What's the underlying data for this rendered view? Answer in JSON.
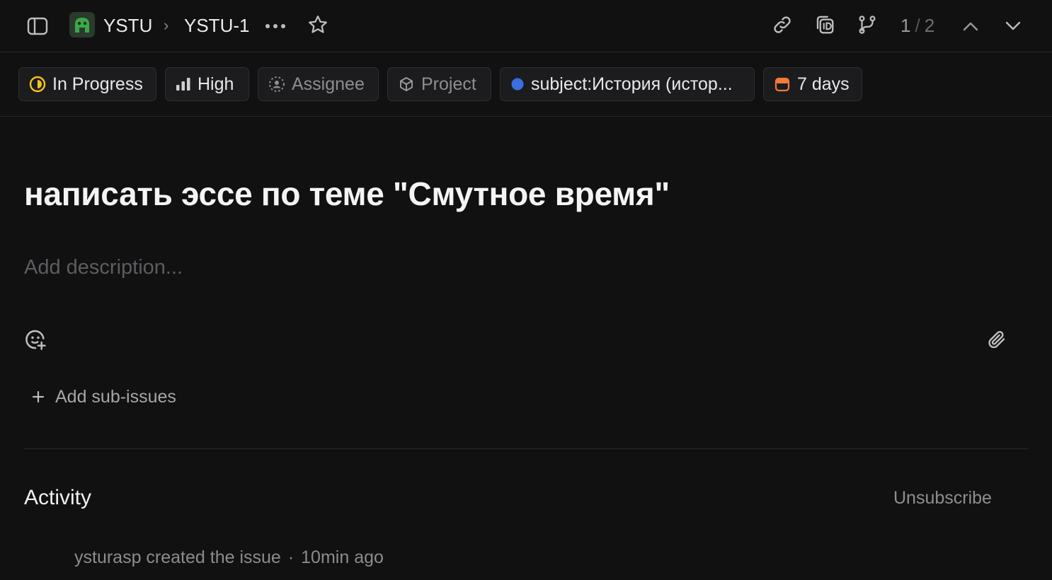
{
  "breadcrumb": {
    "workspace": "YSTU",
    "issue_id": "YSTU-1"
  },
  "pager": {
    "current": "1",
    "separator": "/",
    "total": "2"
  },
  "properties": {
    "status": "In Progress",
    "priority": "High",
    "assignee": "Assignee",
    "project": "Project",
    "label": "subject:История (истор...",
    "due": "7 days"
  },
  "issue": {
    "title": "написать эссе по теме \"Смутное время\"",
    "description_placeholder": "Add description..."
  },
  "sub_issues": {
    "add_label": "Add sub-issues"
  },
  "activity": {
    "heading": "Activity",
    "unsubscribe": "Unsubscribe",
    "entries": [
      {
        "text": "ysturasp created the issue",
        "time": "10min ago"
      }
    ]
  },
  "colors": {
    "background": "#111112",
    "status_yellow": "#f5c518",
    "label_dot": "#3b6fe0",
    "due_orange": "#f27a3a",
    "workspace_green": "#2f8f3a"
  },
  "icons": {
    "sidebar": "sidebar-toggle-icon",
    "workspace": "workspace-logo-icon",
    "more": "more-dots-icon",
    "favorite": "star-icon",
    "link": "link-icon",
    "copy_id": "copy-id-icon",
    "branch": "git-branch-icon",
    "prev": "chevron-up-icon",
    "next": "chevron-down-icon",
    "emoji": "emoji-add-icon",
    "attach": "paperclip-icon",
    "plus": "plus-icon"
  }
}
